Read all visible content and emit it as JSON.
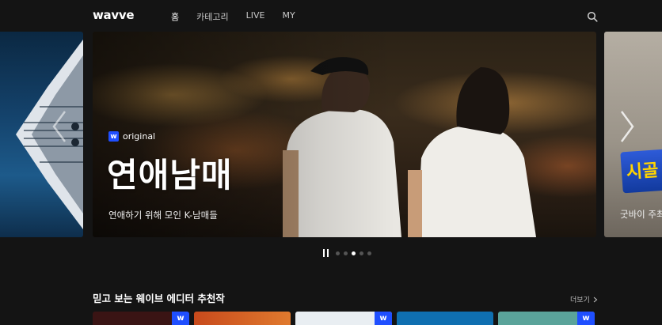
{
  "header": {
    "logo": "wavve",
    "nav": [
      {
        "label": "홈",
        "active": true
      },
      {
        "label": "카테고리",
        "active": false
      },
      {
        "label": "LIVE",
        "active": false
      },
      {
        "label": "MY",
        "active": false
      }
    ],
    "search_icon": "search-icon"
  },
  "carousel": {
    "main": {
      "badge": "original",
      "title": "연애남매",
      "subtitle": "연애하기 위해 모인 K-남매들"
    },
    "right": {
      "caption": "굿바이 주최",
      "logo_text": "시골"
    },
    "pager": {
      "total": 5,
      "active_index": 2
    }
  },
  "section": {
    "title": "믿고 보는 웨이브 에디터 추천작",
    "more_label": "더보기"
  },
  "thumbs": [
    {
      "color": "#3a1414",
      "badge": "w"
    },
    {
      "color": "#d25a22",
      "badge": ""
    },
    {
      "color": "#e9eef2",
      "badge": "w"
    },
    {
      "color": "#0f6fb0",
      "badge": ""
    },
    {
      "color": "#5aa39a",
      "badge": "w"
    }
  ],
  "colors": {
    "background": "#141414",
    "brand_blue": "#1f4fff"
  }
}
